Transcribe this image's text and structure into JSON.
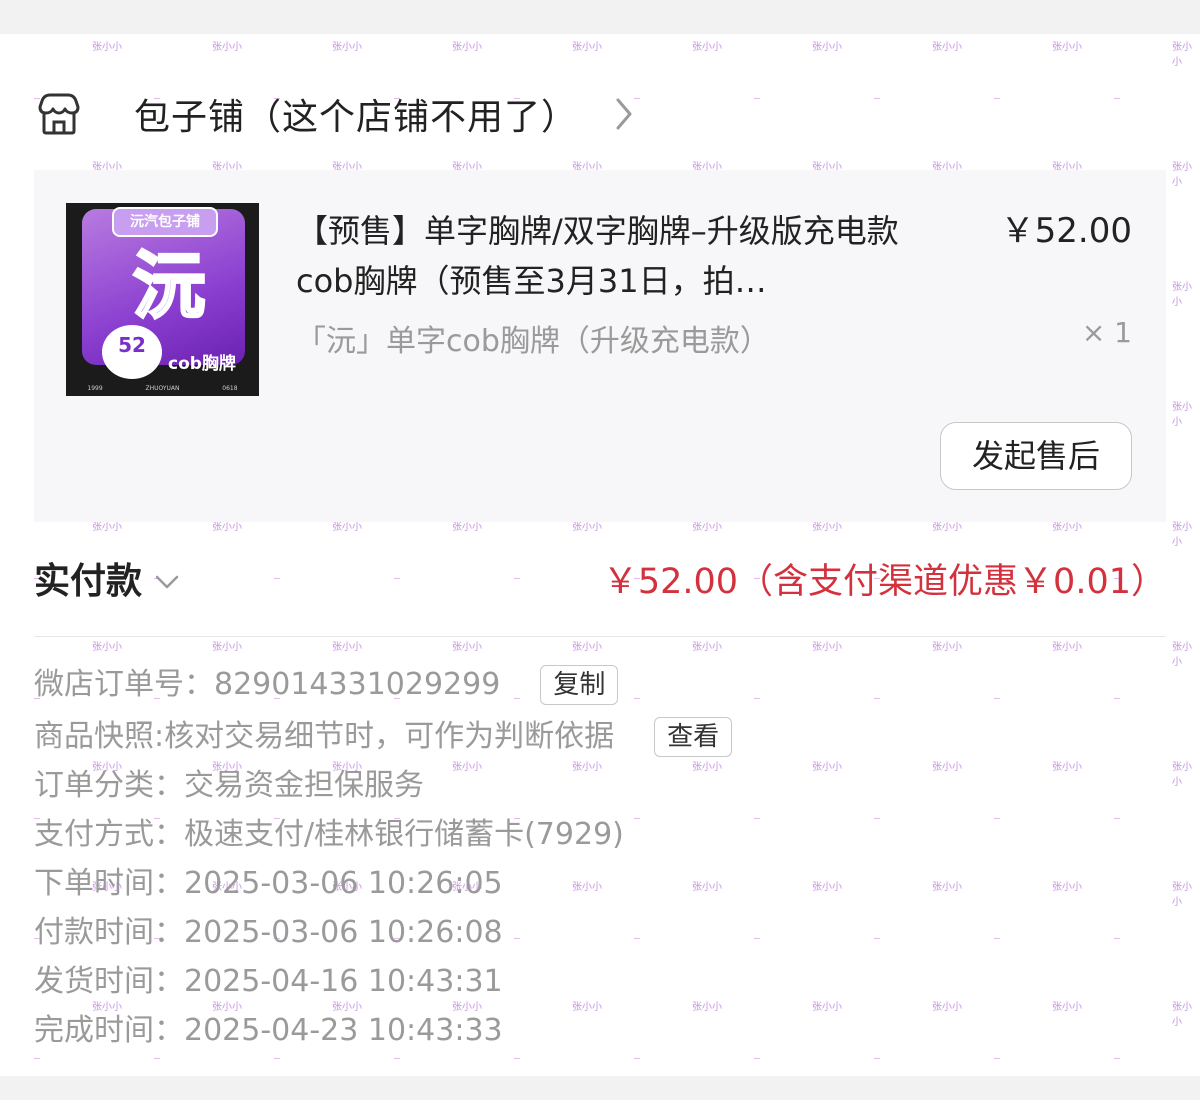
{
  "shop": {
    "name": "包子铺（这个店铺不用了）"
  },
  "product": {
    "title": "【预售】单字胸牌/双字胸牌–升级版充电款cob胸牌（预售至3月31日，拍…",
    "price": "￥52.00",
    "spec": "「沅」单字cob胸牌（升级充电款）",
    "qty": "× 1",
    "after_sale_label": "发起售后",
    "thumbnail": {
      "banner": "沅汽包子铺",
      "glyph": "沅",
      "price_badge": "52",
      "label": "cob胸牌",
      "foot_left": "1999",
      "foot_mid": "ZHUOYUAN",
      "foot_right": "0618"
    }
  },
  "payment": {
    "label": "实付款",
    "value": "￥52.00（含支付渠道优惠￥0.01）"
  },
  "info": {
    "order_no_label": "微店订单号：",
    "order_no": "829014331029299",
    "copy_label": "复制",
    "snapshot_label": "商品快照:",
    "snapshot_text": "核对交易细节时，可作为判断依据",
    "view_label": "查看",
    "category_label": "订单分类：",
    "category": "交易资金担保服务",
    "pay_method_label": "支付方式：",
    "pay_method": "极速支付/桂林银行储蓄卡(7929)",
    "order_time_label": "下单时间：",
    "order_time": "2025-03-06 10:26:05",
    "pay_time_label": "付款时间：",
    "pay_time": "2025-03-06 10:26:08",
    "ship_time_label": "发货时间：",
    "ship_time": "2025-04-16 10:43:31",
    "finish_time_label": "完成时间：",
    "finish_time": "2025-04-23 10:43:33"
  },
  "watermark": {
    "text": "张小小"
  },
  "colors": {
    "price_red": "#d2313d",
    "watermark": "#b56fd6"
  }
}
